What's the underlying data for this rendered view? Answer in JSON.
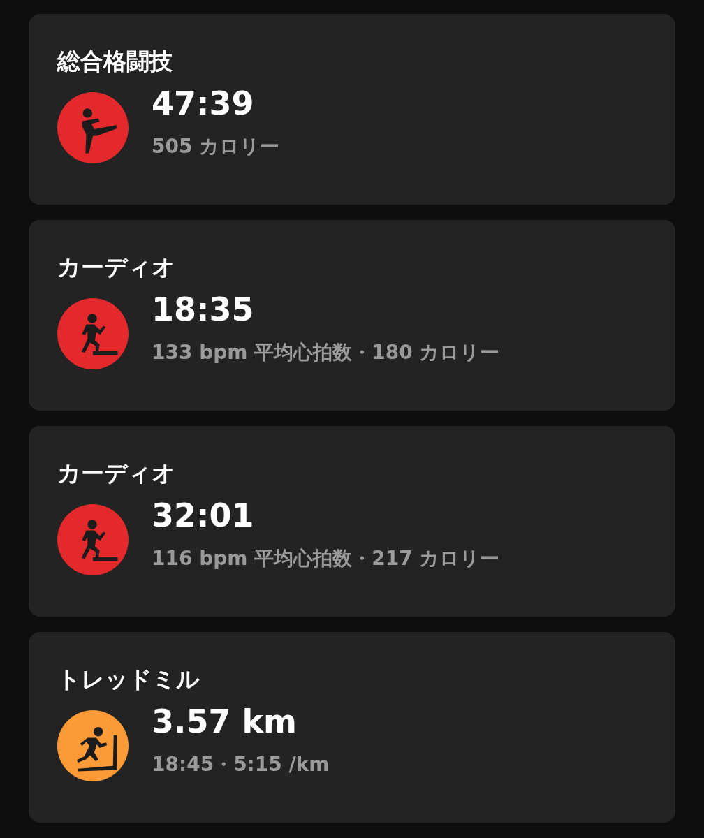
{
  "workouts": [
    {
      "title": "総合格闘技",
      "kind": "kickboxing",
      "color": "#e3292c",
      "value": "47:39",
      "detail": "505 カロリー"
    },
    {
      "title": "カーディオ",
      "kind": "stepper",
      "color": "#e3292c",
      "value": "18:35",
      "detail": "133 bpm 平均心拍数・180 カロリー"
    },
    {
      "title": "カーディオ",
      "kind": "stepper",
      "color": "#e3292c",
      "value": "32:01",
      "detail": "116 bpm 平均心拍数・217 カロリー"
    },
    {
      "title": "トレッドミル",
      "kind": "treadmill",
      "color": "#fd9a38",
      "value": "3.57 km",
      "detail": "18:45・5:15 /km"
    }
  ]
}
